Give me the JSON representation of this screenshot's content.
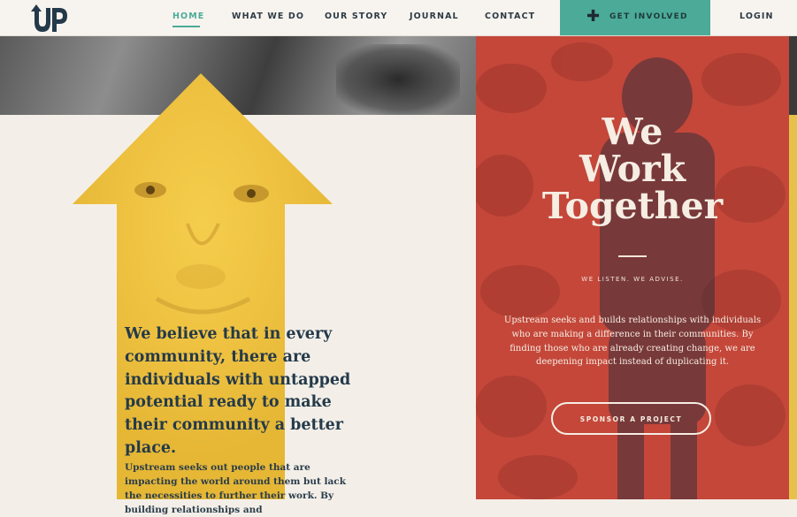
{
  "header": {
    "logo_text": "UP",
    "nav": [
      {
        "label": "HOME"
      },
      {
        "label": "WHAT WE DO"
      },
      {
        "label": "OUR STORY"
      },
      {
        "label": "JOURNAL"
      },
      {
        "label": "CONTACT"
      }
    ],
    "cta_label": "GET INVOLVED",
    "login_label": "LOGIN"
  },
  "left": {
    "heading": "We believe that in every community, there are individuals with untapped potential ready to make their community a better place.",
    "body": "Upstream seeks out people that are impacting the world around them but lack the necessities to further their work. By building relationships and"
  },
  "right": {
    "title_line1": "We",
    "title_line2": "Work",
    "title_line3": "Together",
    "tagline": "WE LISTEN. WE ADVISE.",
    "body": "Upstream seeks and builds relationships with individuals who are making a difference in their communities. By finding those who are already creating change, we are deepening impact instead of duplicating it.",
    "button_label": "SPONSOR A PROJECT"
  },
  "colors": {
    "accent_teal": "#4bab98",
    "navy": "#243a4a",
    "arrow_yellow": "#f2c53d",
    "panel_red": "#c4473a",
    "cream": "#f3efe8"
  },
  "icons": {
    "cta_icon": "plus-icon",
    "logo": "up-arrow-logo"
  }
}
